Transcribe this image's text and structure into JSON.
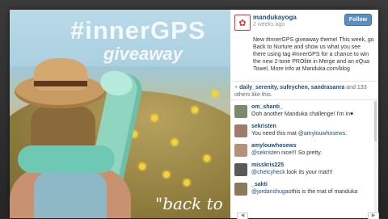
{
  "photo": {
    "title_line1": "#innerGPS",
    "title_line2": "giveaway",
    "footer_text": "\"back to"
  },
  "post": {
    "username": "mandukayoga",
    "time": "2 weeks ago",
    "follow_label": "Follow",
    "caption": "New #innerGPS giveaway theme! This week, go Back to Nurture and show us what you see there using tag #innerGPS for a chance to win the new 2-tone PROlite in Merge and an eQua Towel. More info at Manduka.com/blog",
    "likes": {
      "users": "daily_serenity, sufeychen, sandrasanra",
      "rest": "and 133 others like this."
    }
  },
  "comments": [
    {
      "user": "om_shanti_",
      "text": "Ooh another Manduka challenge! I'm in♥",
      "mention": ""
    },
    {
      "user": "sekristen",
      "text": "You need this mat ",
      "mention": "@amylouwhosews."
    },
    {
      "user": "amylouwhosews",
      "text": " nice!!! So pretty.",
      "mention": "@sekristen"
    },
    {
      "user": "misskris225",
      "text": " look its your mat!!!",
      "mention": "@chelcyheck"
    },
    {
      "user": "_sakti",
      "text": "this is the mat of manduka",
      "mention": "@jordanshugao"
    }
  ],
  "colors": {
    "link": "#1f4c7a",
    "follow_button": "#5a8fc2",
    "mat": "#8fd5c0"
  }
}
